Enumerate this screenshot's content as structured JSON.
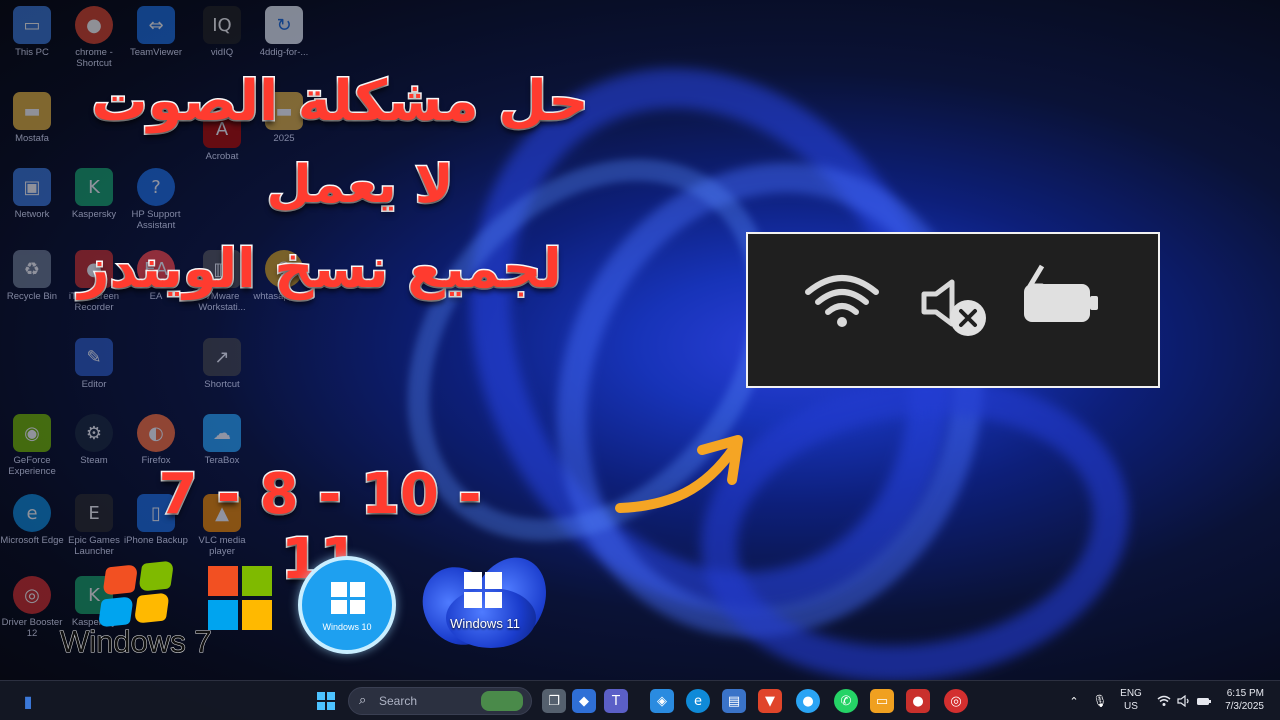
{
  "headline": {
    "line1": "حل مشكلة الصوت",
    "line2": "لا يعمل",
    "line3": "لجميع نسخ الويندز",
    "versions": "7 - 8 - 10 - 11"
  },
  "desktop_icons": [
    {
      "label": "This PC",
      "icon": "monitor-icon"
    },
    {
      "label": "chrome - Shortcut",
      "icon": "chrome-icon"
    },
    {
      "label": "TeamViewer",
      "icon": "teamviewer-icon"
    },
    {
      "label": "vidIQ",
      "icon": "vidiq-icon"
    },
    {
      "label": "4ddig-for-...",
      "icon": "4ddig-icon"
    },
    {
      "label": "Mostafa",
      "icon": "folder-icon"
    },
    {
      "label": "Acrobat",
      "icon": "acrobat-icon"
    },
    {
      "label": "2025",
      "icon": "folder-icon"
    },
    {
      "label": "Network",
      "icon": "network-icon"
    },
    {
      "label": "Kaspersky",
      "icon": "kaspersky-icon"
    },
    {
      "label": "HP Support Assistant",
      "icon": "help-icon"
    },
    {
      "label": "Recycle Bin",
      "icon": "recycle-bin-icon"
    },
    {
      "label": "iTop Screen Recorder",
      "icon": "recorder-icon"
    },
    {
      "label": "EA",
      "icon": "ea-icon"
    },
    {
      "label": "VMware Workstati...",
      "icon": "vmware-icon"
    },
    {
      "label": "whtasapp gold",
      "icon": "whatsapp-icon"
    },
    {
      "label": "Editor",
      "icon": "editor-icon"
    },
    {
      "label": "Shortcut",
      "icon": "shortcut-icon"
    },
    {
      "label": "GeForce Experience",
      "icon": "nvidia-icon"
    },
    {
      "label": "Steam",
      "icon": "steam-icon"
    },
    {
      "label": "Firefox",
      "icon": "firefox-icon"
    },
    {
      "label": "TeraBox",
      "icon": "terabox-icon"
    },
    {
      "label": "Microsoft Edge",
      "icon": "edge-icon"
    },
    {
      "label": "Epic Games Launcher",
      "icon": "epic-icon"
    },
    {
      "label": "iPhone Backup",
      "icon": "iphone-icon"
    },
    {
      "label": "VLC media player",
      "icon": "vlc-icon"
    },
    {
      "label": "Driver Booster 12",
      "icon": "driver-booster-icon"
    },
    {
      "label": "Kaspersky",
      "icon": "kaspersky-icon"
    }
  ],
  "logos": {
    "win7": "Windows 7",
    "win10": "Windows 10",
    "win11": "Windows 11"
  },
  "taskbar": {
    "search_placeholder": "Search",
    "lang_line1": "ENG",
    "lang_line2": "US",
    "time": "6:15 PM",
    "date": "7/3/2025"
  },
  "colors": {
    "headline_red": "#ff3b2f",
    "arrow_orange": "#f5a524",
    "zoom_panel_bg": "#1f1f1f"
  }
}
